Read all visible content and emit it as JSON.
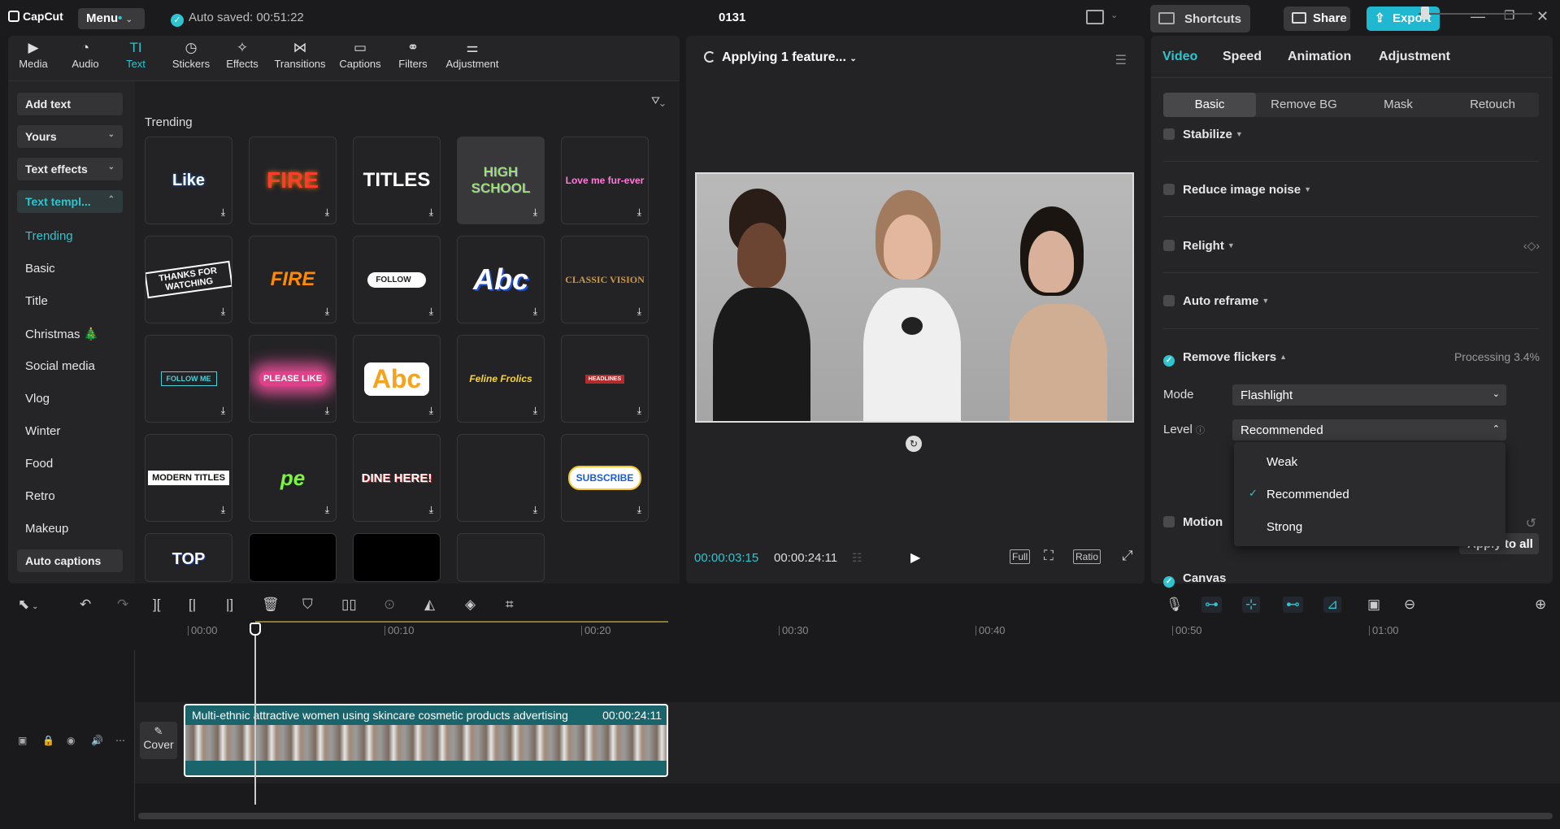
{
  "app": {
    "logo": "CapCut",
    "menu_label": "Menu",
    "autosave": "Auto saved: 00:51:22",
    "project_title": "0131",
    "shortcuts_label": "Shortcuts",
    "share_label": "Share",
    "export_label": "Export"
  },
  "tool_tabs": [
    "Media",
    "Audio",
    "Text",
    "Stickers",
    "Effects",
    "Transitions",
    "Captions",
    "Filters",
    "Adjustment"
  ],
  "sidebar": {
    "buttons": [
      "Add text",
      "Yours",
      "Text effects",
      "Text templ..."
    ],
    "items": [
      "Trending",
      "Basic",
      "Title",
      "Christmas 🎄",
      "Social media",
      "Vlog",
      "Winter",
      "Food",
      "Retro",
      "Makeup"
    ],
    "auto_captions": "Auto captions"
  },
  "content": {
    "section_title": "Trending",
    "tiles": [
      "Like",
      "FIRE",
      "TITLES",
      "HIGH SCHOOL",
      "Love me fur-ever",
      "THANKS FOR WATCHING",
      "FIRE",
      "FOLLOW",
      "Abc",
      "CLASSIC VISION",
      "FOLLOW ME",
      "PLEASE LIKE",
      "Abc",
      "Feline Frolics",
      "HEADLINES",
      "MODERN TITLES",
      "pe",
      "DINE HERE!",
      "",
      "SUBSCRIBE",
      "TOP",
      "",
      "",
      ""
    ]
  },
  "preview": {
    "status": "Applying 1 feature...",
    "current_time": "00:00:03:15",
    "total_time": "00:00:24:11",
    "controls": [
      "Full",
      "Ratio"
    ]
  },
  "inspector": {
    "tabs": [
      "Video",
      "Speed",
      "Animation",
      "Adjustment"
    ],
    "subtabs": [
      "Basic",
      "Remove BG",
      "Mask",
      "Retouch"
    ],
    "options": [
      "Stabilize",
      "Reduce image noise",
      "Relight",
      "Auto reframe",
      "Remove flickers",
      "Motion",
      "Canvas"
    ],
    "processing": "Processing 3.4%",
    "mode_label": "Mode",
    "mode_value": "Flashlight",
    "level_label": "Level",
    "level_value": "Recommended",
    "level_options": [
      "Weak",
      "Recommended",
      "Strong"
    ],
    "apply_all": "Apply to all"
  },
  "timeline": {
    "ticks": [
      "00:00",
      "00:10",
      "00:20",
      "00:30",
      "00:40",
      "00:50",
      "01:00"
    ],
    "clip_title": "Multi-ethnic attractive women using skincare cosmetic products advertising",
    "clip_duration": "00:00:24:11",
    "cover_label": "Cover"
  },
  "colors": {
    "accent": "#2ec5ce",
    "export": "#1fb8d0"
  }
}
